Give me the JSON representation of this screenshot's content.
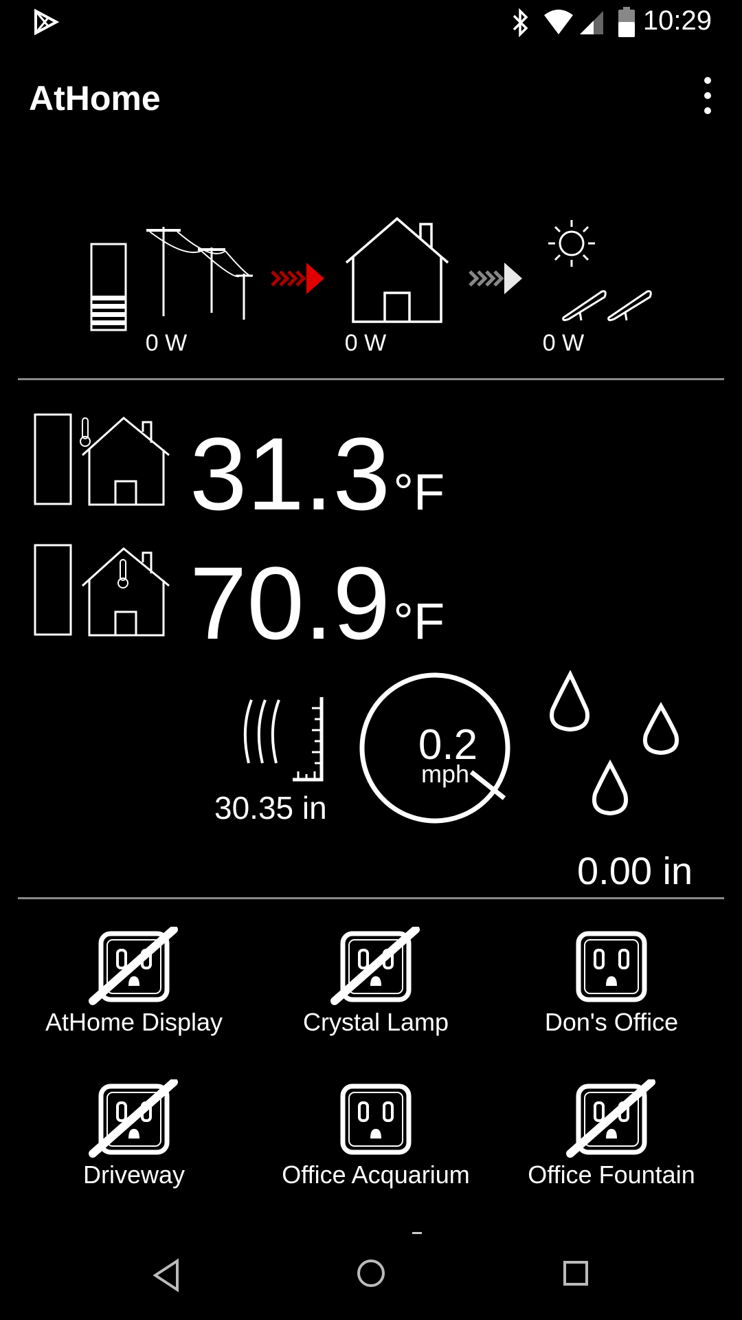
{
  "status_bar": {
    "time": "10:29",
    "icons": [
      "play-store-icon",
      "bluetooth-icon",
      "wifi-icon",
      "cell-signal-icon",
      "battery-icon"
    ]
  },
  "app_bar": {
    "title": "AtHome",
    "menu_icon": "more-vert-icon"
  },
  "power": {
    "grid": {
      "label": "0 W",
      "icon": "power-grid-icon"
    },
    "house": {
      "label": "0 W",
      "icon": "house-icon"
    },
    "solar": {
      "label": "0 W",
      "icon": "solar-panel-icon"
    },
    "flow_arrow_colors": {
      "grid_to_house": "#e00000",
      "house_to_solar": "#bdbdbd"
    }
  },
  "temperatures": {
    "outdoor": {
      "value": "31.3",
      "unit": "°F",
      "icon": "outdoor-thermometer-house-icon"
    },
    "indoor": {
      "value": "70.9",
      "unit": "°F",
      "icon": "indoor-thermometer-house-icon"
    }
  },
  "weather": {
    "pressure": {
      "value": "30.35 in",
      "icon": "barometer-icon"
    },
    "wind": {
      "value": "0.2",
      "unit": "mph",
      "icon": "wind-gauge-icon"
    },
    "rain": {
      "value": "0.00 in",
      "icon": "raindrops-icon"
    }
  },
  "outlets": [
    {
      "label": "AtHome Display",
      "state": "off"
    },
    {
      "label": "Crystal Lamp",
      "state": "off"
    },
    {
      "label": "Don's Office",
      "state": "on"
    },
    {
      "label": "Driveway",
      "state": "off"
    },
    {
      "label": "Office Acquarium",
      "state": "on"
    },
    {
      "label": "Office Fountain",
      "state": "off"
    }
  ],
  "nav_bar": {
    "back": "back-icon",
    "home": "home-icon",
    "recents": "recents-icon"
  }
}
